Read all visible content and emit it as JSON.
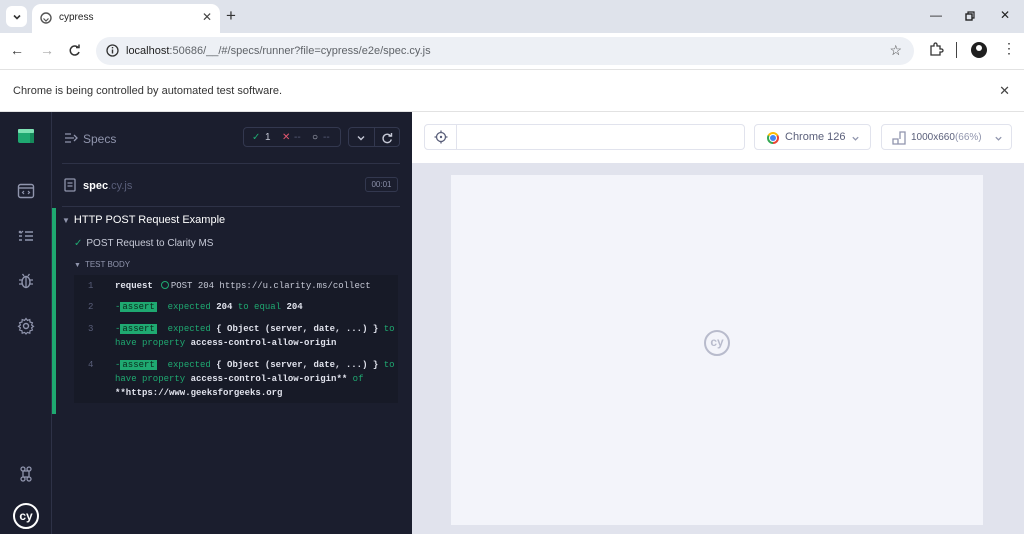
{
  "browser": {
    "tab_title": "cypress",
    "new_tab_glyph": "+",
    "url_host": "localhost",
    "url_rest": ":50686/__/#/specs/runner?file=cypress/e2e/spec.cy.js",
    "infobar_text": "Chrome is being controlled by automated test software."
  },
  "nav": {
    "items": [
      "cypress-specs-icon",
      "runs-icon",
      "debug-icon",
      "settings-icon",
      "keyboard-shortcuts-icon",
      "cypress-logo-icon"
    ]
  },
  "reporter": {
    "specs_label": "Specs",
    "stats": {
      "passed": "1",
      "failed": "--",
      "pending": "--"
    },
    "spec_name": "spec",
    "spec_ext": ".cy.js",
    "duration": "00:01",
    "suite_title": "HTTP POST Request Example",
    "test_title": "POST Request to Clarity MS",
    "body_label": "TEST BODY",
    "commands": [
      {
        "num": "1",
        "name": "request",
        "text": "POST 204 https://u.clarity.ms/collect"
      },
      {
        "num": "2",
        "prefix": "-",
        "name": "assert",
        "text_a": "expected",
        "text_b": "204",
        "text_c": "to equal",
        "text_d": "204"
      },
      {
        "num": "3",
        "prefix": "-",
        "name": "assert",
        "text_a": "expected",
        "text_b": "{ Object (server, date, ...) }",
        "text_c": "to have property",
        "text_d": "access-control-allow-origin"
      },
      {
        "num": "4",
        "prefix": "-",
        "name": "assert",
        "text_a": "expected",
        "text_b": "{ Object (server, date, ...) }",
        "text_c": "to have property",
        "text_d": "access-control-allow-origin**",
        "text_e": "of",
        "text_f": "**https://www.geeksforgeeks.org"
      }
    ]
  },
  "preview": {
    "browser_name": "Chrome 126",
    "viewport": "1000x660",
    "viewport_scale": "(66%)",
    "logo_text": "cy"
  },
  "colors": {
    "pass": "#1fa971",
    "runner_bg": "#1b1e2e",
    "preview_bg": "#e1e3ed"
  }
}
